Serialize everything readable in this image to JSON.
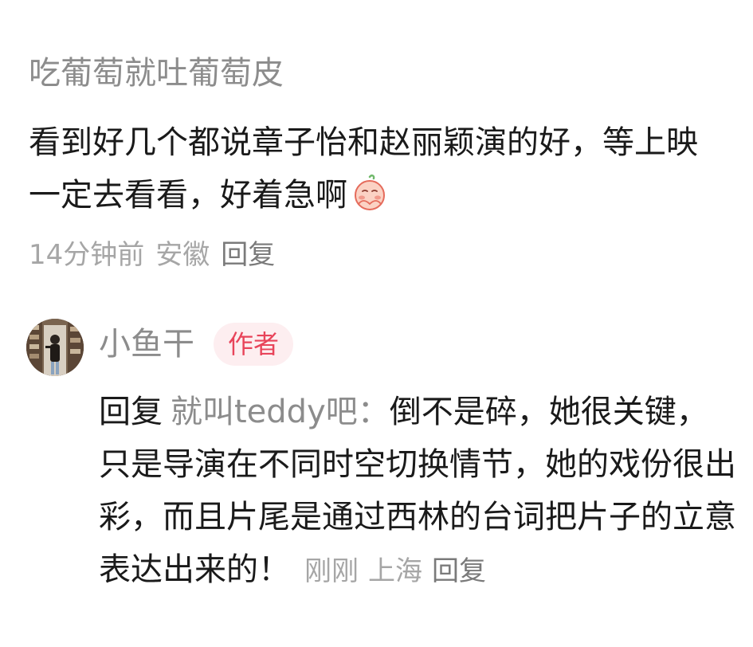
{
  "comment": {
    "username": "吃葡萄就吐葡萄皮",
    "text": "看到好几个都说章子怡和赵丽颖演的好，等上映一定去看看，好着急啊",
    "emoji_icon": "shy-blushing-face-emoji",
    "time": "14分钟前",
    "location": "安徽",
    "reply_label": "回复"
  },
  "reply": {
    "username": "小鱼干",
    "badge": "作者",
    "reply_prefix": "回复",
    "reply_target": "就叫teddy吧：",
    "text": "倒不是碎，她很关键，只是导演在不同时空切换情节，她的戏份很出彩，而且片尾是通过西林的台词把片子的立意表达出来的！",
    "time": "刚刚",
    "location": "上海",
    "reply_label": "回复"
  },
  "colors": {
    "badge_bg": "#fdeef0",
    "badge_text": "#e8445a",
    "muted_text": "#8c8c8c",
    "primary_text": "#1a1a1a"
  }
}
